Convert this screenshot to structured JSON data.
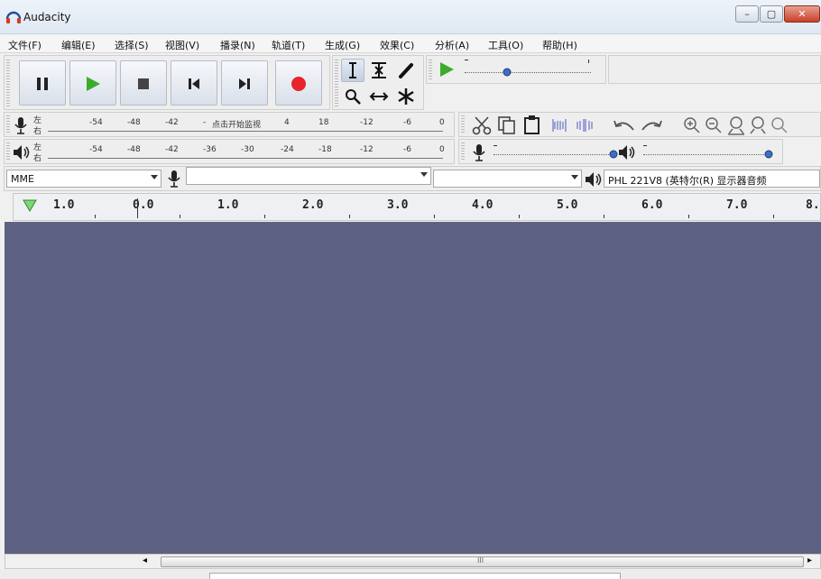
{
  "window": {
    "title": "Audacity",
    "minimize": "–",
    "maximize": "▢",
    "close": "✕"
  },
  "menu": [
    "文件(F)",
    "编辑(E)",
    "选择(S)",
    "视图(V)",
    "播录(N)",
    "轨道(T)",
    "生成(G)",
    "效果(C)",
    "分析(A)",
    "工具(O)",
    "帮助(H)"
  ],
  "meters": {
    "record_scale": [
      "-54",
      "-48",
      "-42",
      "-",
      "18",
      "-12",
      "-6",
      "0"
    ],
    "record_hint": "点击开始监视",
    "record_hint_tail": "4",
    "play_scale": [
      "-54",
      "-48",
      "-42",
      "-36",
      "-30",
      "-24",
      "-18",
      "-12",
      "-6",
      "0"
    ],
    "channel_left": "左",
    "channel_right": "右"
  },
  "device": {
    "host": "MME",
    "recording_device": "",
    "recording_channels": "",
    "playback_device": "PHL 221V8 (英特尔(R) 显示器音频"
  },
  "ruler": {
    "labels": [
      "1.0",
      "0.0",
      "1.0",
      "2.0",
      "3.0",
      "4.0",
      "5.0",
      "6.0",
      "7.0",
      "8."
    ]
  },
  "scrollbar": {
    "grip": "III",
    "left_arrow": "◂",
    "right_arrow": "▸"
  },
  "colors": {
    "track_bg": "#5d6282",
    "play_green": "#3cab2c",
    "record_red": "#e8242c",
    "accent_blue": "#3a6fc4"
  }
}
